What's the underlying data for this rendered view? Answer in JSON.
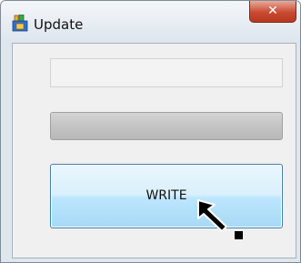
{
  "window": {
    "title": "Update",
    "close_label": "✕"
  },
  "progress": {
    "fraction": 0.0
  },
  "write_button": {
    "label": "WRITE"
  },
  "icons": {
    "app": "package-icon",
    "cursor": "pointer-cursor-icon"
  }
}
